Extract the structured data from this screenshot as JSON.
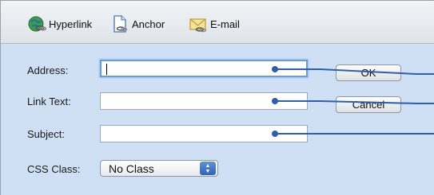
{
  "toolbar": {
    "tabs": [
      {
        "label": "Hyperlink",
        "icon": "globe-link-icon"
      },
      {
        "label": "Anchor",
        "icon": "anchor-page-icon"
      },
      {
        "label": "E-mail",
        "icon": "email-envelope-icon"
      }
    ]
  },
  "form": {
    "address_label": "Address:",
    "address_value": "",
    "link_text_label": "Link Text:",
    "link_text_value": "",
    "subject_label": "Subject:",
    "subject_value": "",
    "css_class_label": "CSS Class:",
    "css_class_value": "No Class"
  },
  "buttons": {
    "ok": "OK",
    "cancel": "Cancel"
  },
  "colors": {
    "panel_bg": "#cfe0f5",
    "callout_line": "#2f5fa8",
    "focus_ring": "#6d9bd6"
  }
}
